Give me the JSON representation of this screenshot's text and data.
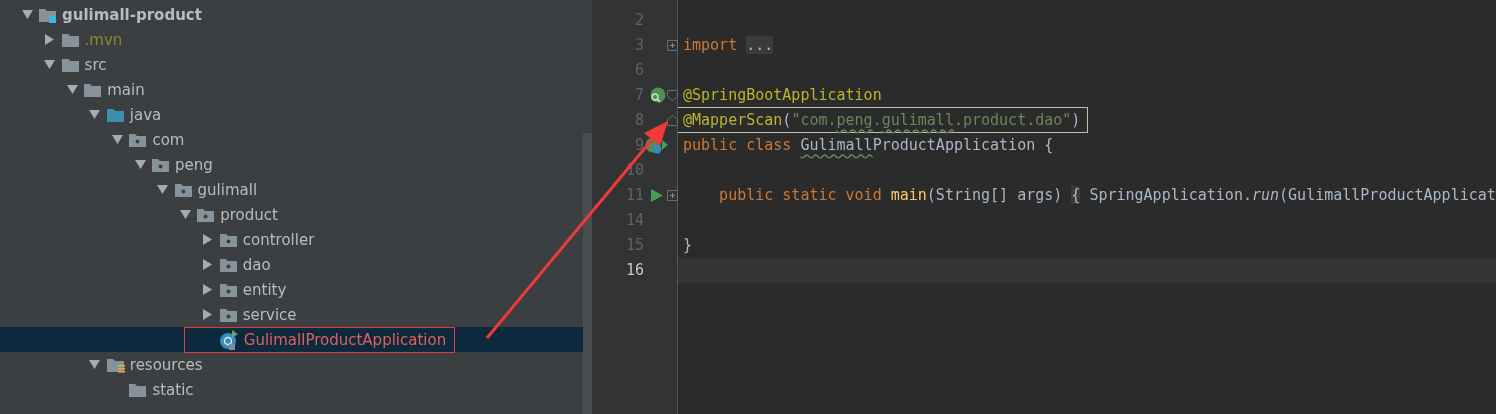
{
  "project_tree": {
    "items": [
      {
        "name": "gulimall-product",
        "kind": "module",
        "expanded": true,
        "selected": false,
        "excluded": false,
        "error": false,
        "annotated": false,
        "children": [
          {
            "name": ".mvn",
            "kind": "folder",
            "expanded": false,
            "selected": false,
            "excluded": true,
            "error": false,
            "annotated": false
          },
          {
            "name": "src",
            "kind": "folder",
            "expanded": true,
            "selected": false,
            "excluded": false,
            "error": false,
            "annotated": false,
            "children": [
              {
                "name": "main",
                "kind": "folder",
                "expanded": true,
                "selected": false,
                "excluded": false,
                "error": false,
                "annotated": false,
                "children": [
                  {
                    "name": "java",
                    "kind": "source_folder",
                    "expanded": true,
                    "selected": false,
                    "excluded": false,
                    "error": false,
                    "annotated": false,
                    "children": [
                      {
                        "name": "com",
                        "kind": "package",
                        "expanded": true,
                        "selected": false,
                        "excluded": false,
                        "error": false,
                        "annotated": false,
                        "children": [
                          {
                            "name": "peng",
                            "kind": "package",
                            "expanded": true,
                            "selected": false,
                            "excluded": false,
                            "error": false,
                            "annotated": false,
                            "children": [
                              {
                                "name": "gulimall",
                                "kind": "package",
                                "expanded": true,
                                "selected": false,
                                "excluded": false,
                                "error": false,
                                "annotated": false,
                                "children": [
                                  {
                                    "name": "product",
                                    "kind": "package",
                                    "expanded": true,
                                    "selected": false,
                                    "excluded": false,
                                    "error": false,
                                    "annotated": false,
                                    "children": [
                                      {
                                        "name": "controller",
                                        "kind": "package",
                                        "expanded": false,
                                        "selected": false,
                                        "excluded": false,
                                        "error": false,
                                        "annotated": false
                                      },
                                      {
                                        "name": "dao",
                                        "kind": "package",
                                        "expanded": false,
                                        "selected": false,
                                        "excluded": false,
                                        "error": false,
                                        "annotated": false
                                      },
                                      {
                                        "name": "entity",
                                        "kind": "package",
                                        "expanded": false,
                                        "selected": false,
                                        "excluded": false,
                                        "error": false,
                                        "annotated": false
                                      },
                                      {
                                        "name": "service",
                                        "kind": "package",
                                        "expanded": false,
                                        "selected": false,
                                        "excluded": false,
                                        "error": false,
                                        "annotated": false
                                      },
                                      {
                                        "name": "GulimallProductApplication",
                                        "kind": "class",
                                        "selected": true,
                                        "excluded": false,
                                        "error": true,
                                        "annotated": true
                                      }
                                    ]
                                  }
                                ]
                              }
                            ]
                          }
                        ]
                      }
                    ]
                  },
                  {
                    "name": "resources",
                    "kind": "resource_folder",
                    "expanded": true,
                    "selected": false,
                    "excluded": false,
                    "error": false,
                    "annotated": false,
                    "children": [
                      {
                        "name": "static",
                        "kind": "folder",
                        "selected": false,
                        "excluded": false,
                        "error": false,
                        "annotated": false
                      }
                    ]
                  }
                ]
              }
            ]
          }
        ]
      }
    ]
  },
  "editor": {
    "lines": [
      {
        "number": "2",
        "current": false,
        "annotated": false
      },
      {
        "number": "3",
        "current": false,
        "annotated": false,
        "fold": {
          "kind": "plus"
        },
        "tokens": [
          {
            "kind": "keyword",
            "text": "import "
          },
          {
            "kind": "folded",
            "text": "..."
          }
        ]
      },
      {
        "number": "6",
        "current": false,
        "annotated": false
      },
      {
        "number": "7",
        "current": false,
        "annotated": false,
        "fold": {
          "kind": "start"
        },
        "gutter": {
          "kind": "bean"
        },
        "tokens": [
          {
            "kind": "annotation",
            "text": "@SpringBootApplication"
          }
        ]
      },
      {
        "number": "8",
        "current": false,
        "annotated": true,
        "fold": {
          "kind": "end"
        },
        "tokens": [
          {
            "kind": "annotation",
            "text": "@MapperScan"
          },
          {
            "kind": "plain",
            "text": "("
          },
          {
            "kind": "string",
            "text": "\"com."
          },
          {
            "kind": "string",
            "text": "peng",
            "typo": true
          },
          {
            "kind": "string",
            "text": "."
          },
          {
            "kind": "string",
            "text": "gulimall",
            "typo": true
          },
          {
            "kind": "string",
            "text": ".product.dao\""
          },
          {
            "kind": "plain",
            "text": ")"
          }
        ]
      },
      {
        "number": "9",
        "current": false,
        "annotated": false,
        "gutter": {
          "kind": "spring"
        },
        "tokens": [
          {
            "kind": "keyword",
            "text": "public class "
          },
          {
            "kind": "plain",
            "text": "Gulimall",
            "typo": true
          },
          {
            "kind": "plain",
            "text": "ProductApplication {"
          }
        ]
      },
      {
        "number": "10",
        "current": false,
        "annotated": false
      },
      {
        "number": "11",
        "current": false,
        "annotated": false,
        "fold": {
          "kind": "plus"
        },
        "gutter": {
          "kind": "run"
        },
        "tokens": [
          {
            "kind": "keyword",
            "text": "    public static void "
          },
          {
            "kind": "method",
            "text": "main"
          },
          {
            "kind": "plain",
            "text": "(String[] args) "
          },
          {
            "kind": "folded",
            "text": "{"
          },
          {
            "kind": "plain",
            "text": " SpringApplication."
          },
          {
            "kind": "italic",
            "text": "run"
          },
          {
            "kind": "plain",
            "text": "(GulimallProductApplicat"
          }
        ]
      },
      {
        "number": "14",
        "current": false,
        "annotated": false
      },
      {
        "number": "15",
        "current": false,
        "annotated": false,
        "tokens": [
          {
            "kind": "plain",
            "text": "}"
          }
        ]
      },
      {
        "number": "16",
        "current": true,
        "annotated": false
      }
    ]
  }
}
